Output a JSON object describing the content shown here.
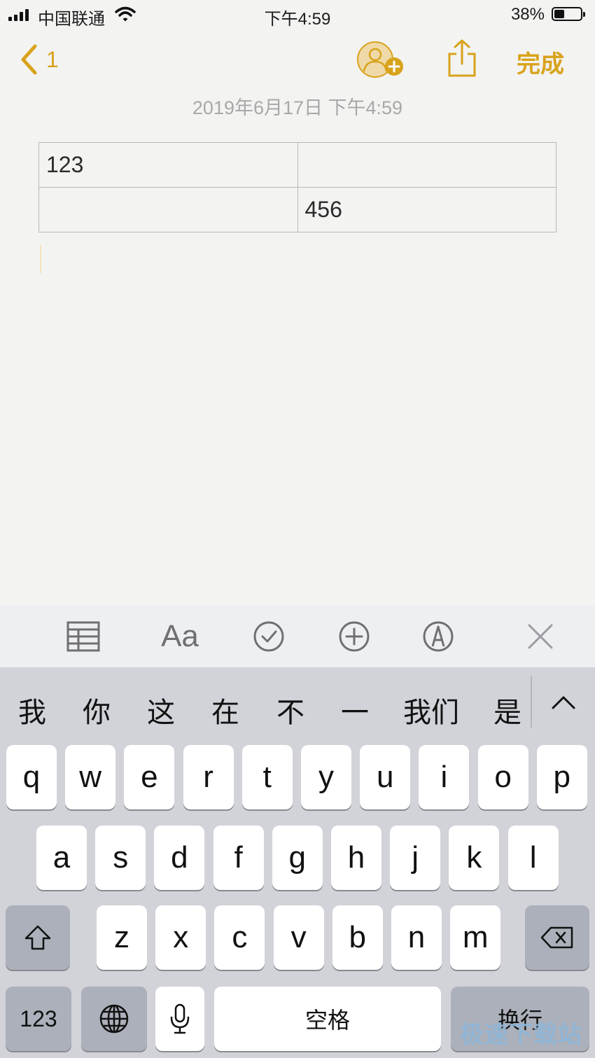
{
  "status_bar": {
    "carrier": "中国联通",
    "time": "下午4:59",
    "battery_percent": "38%",
    "battery_level": 0.38
  },
  "nav": {
    "back_count": "1",
    "done_label": "完成"
  },
  "note": {
    "date": "2019年6月17日 下午4:59",
    "table": [
      [
        "123",
        ""
      ],
      [
        "",
        "456"
      ]
    ]
  },
  "format_toolbar": [
    "table-icon",
    "text-format-icon",
    "checklist-icon",
    "add-icon",
    "markup-icon",
    "close-icon"
  ],
  "format_toolbar_text": {
    "text_format": "Aa"
  },
  "keyboard": {
    "candidates": [
      "我",
      "你",
      "这",
      "在",
      "不",
      "一",
      "我们",
      "是"
    ],
    "row1": [
      "q",
      "w",
      "e",
      "r",
      "t",
      "y",
      "u",
      "i",
      "o",
      "p"
    ],
    "row2": [
      "a",
      "s",
      "d",
      "f",
      "g",
      "h",
      "j",
      "k",
      "l"
    ],
    "row3": [
      "z",
      "x",
      "c",
      "v",
      "b",
      "n",
      "m"
    ],
    "numbers_label": "123",
    "space_label": "空格",
    "return_label": "换行"
  },
  "watermark": "极速下载站",
  "colors": {
    "accent": "#d8a31b",
    "keyboard_bg": "#d1d3d9"
  }
}
